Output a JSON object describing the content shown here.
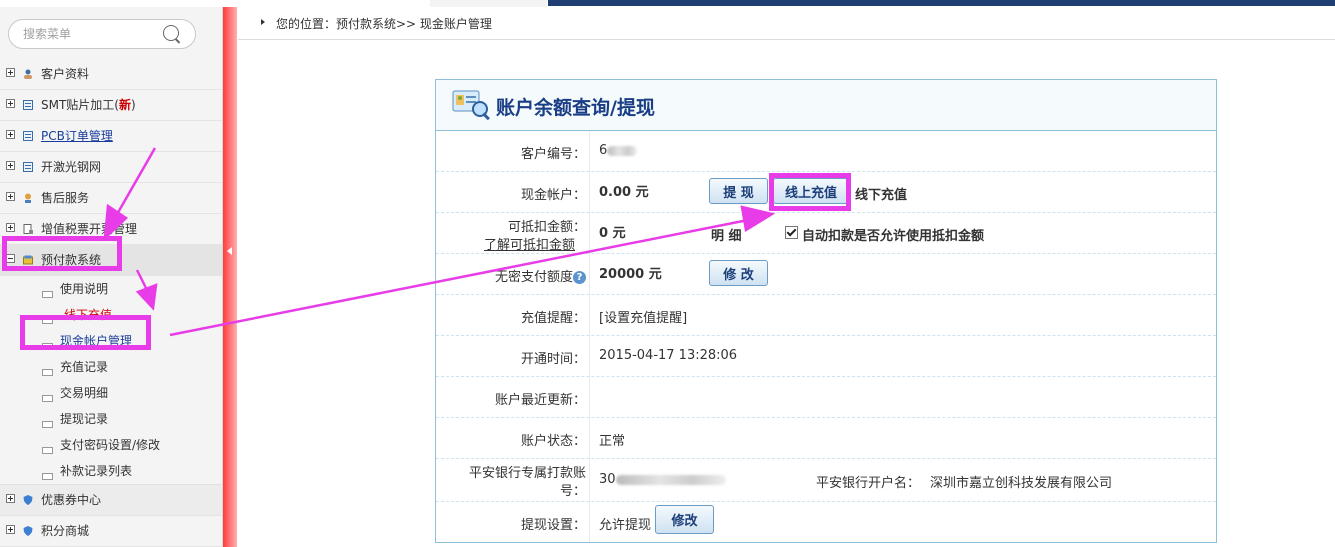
{
  "search": {
    "placeholder": "搜索菜单"
  },
  "sidebar": {
    "items": [
      {
        "label": "客户资料"
      },
      {
        "label": "SMT贴片加工(",
        "badge": "新",
        "suffix": ")"
      },
      {
        "label": "PCB订单管理"
      },
      {
        "label": "开激光钢网"
      },
      {
        "label": "售后服务"
      },
      {
        "label": "增值税票开票管理"
      },
      {
        "label": "预付款系统"
      }
    ],
    "subitems": [
      {
        "label": "使用说明"
      },
      {
        "label": "线下充值"
      },
      {
        "label": "现金帐户管理"
      },
      {
        "label": "充值记录"
      },
      {
        "label": "交易明细"
      },
      {
        "label": "提现记录"
      },
      {
        "label": "支付密码设置/修改"
      },
      {
        "label": "补款记录列表"
      }
    ],
    "bottom_items": [
      {
        "label": "优惠券中心"
      },
      {
        "label": "积分商城"
      }
    ]
  },
  "breadcrumb": {
    "text": "您的位置：预付款系统>> 现金账户管理"
  },
  "panel": {
    "title": "账户余额查询/提现",
    "rows": {
      "customer_no": {
        "label": "客户编号：",
        "value": "6"
      },
      "cash_account": {
        "label": "现金帐户：",
        "value": "0.00 元",
        "withdraw_btn": "提 现",
        "online_btn": "线上充值",
        "offline_link": "线下充值"
      },
      "deductible": {
        "label": "可抵扣金额：",
        "help_link": "了解可抵扣金额",
        "value": "0 元",
        "detail": "明 细",
        "auto_label": "自动扣款是否允许使用抵扣金额"
      },
      "nopwd": {
        "label": "无密支付额度",
        "value": "20000 元",
        "modify_btn": "修 改"
      },
      "reminder": {
        "label": "充值提醒：",
        "value": "[设置充值提醒]"
      },
      "opened": {
        "label": "开通时间：",
        "value": "2015-04-17 13:28:06"
      },
      "updated": {
        "label": "账户最近更新：",
        "value": ""
      },
      "status": {
        "label": "账户状态：",
        "value": "正常"
      },
      "bank": {
        "label_line1": "平安银行专属打款账",
        "label_line2": "号：",
        "value": "30",
        "name_label": "平安银行开户名：",
        "name_value": "深圳市嘉立创科技发展有限公司"
      },
      "withdraw_setting": {
        "label": "提现设置：",
        "value": "允许提现",
        "modify_btn": "修改"
      }
    }
  },
  "colors": {
    "highlight": "#e83ce8",
    "money": "#cc0000",
    "title": "#1a3e86"
  }
}
